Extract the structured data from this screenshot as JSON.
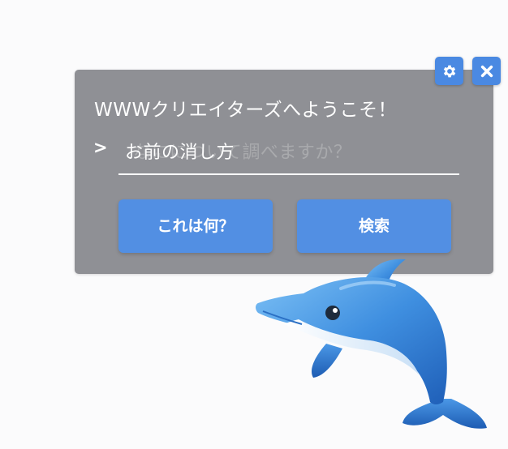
{
  "assistant": {
    "welcome_text": "WWWクリエイターズへようこそ！",
    "prompt_caret": ">",
    "query_placeholder": "なにについて調べますか？",
    "query_value": "お前の消し方",
    "help_button_label": "これは何？",
    "search_button_label": "検索"
  },
  "controls": {
    "settings_icon": "gear-icon",
    "close_icon": "close-icon"
  },
  "mascot": {
    "icon": "dolphin-icon"
  },
  "colors": {
    "panel_bg": "#8f9095",
    "button_blue": "#528fe3",
    "icon_button_blue": "#4a89e2"
  }
}
